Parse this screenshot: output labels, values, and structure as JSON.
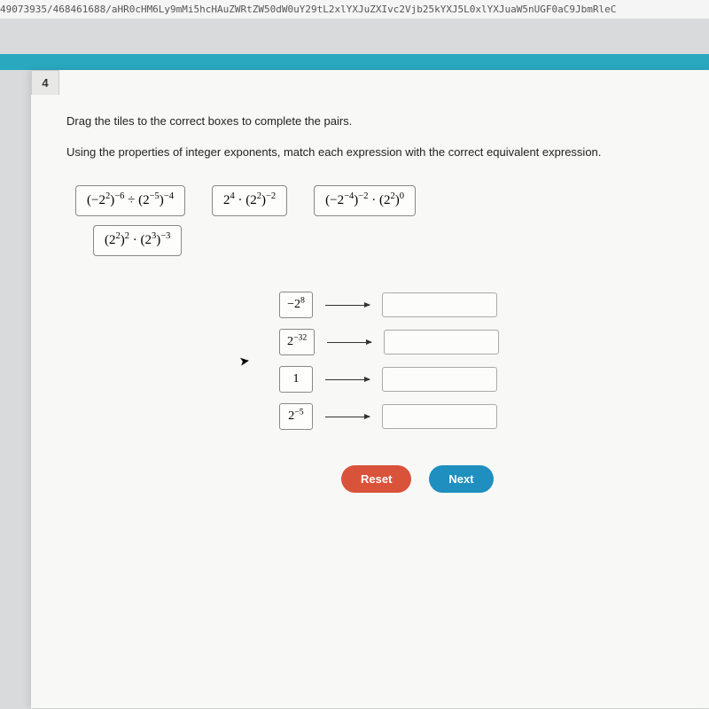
{
  "url": "49073935/468461688/aHR0cHM6Ly9mMi5hcHAuZWRtZW50dW0uY29tL2xlYXJuZXIvc2Vjb25kYXJ5L0xlYXJuaW5nUGF0aC9JbmRleC",
  "question": {
    "number": "4",
    "instruction": "Drag the tiles to the correct boxes to complete the pairs.",
    "subinstruction": "Using the properties of integer exponents, match each expression with the correct equivalent expression."
  },
  "tiles": {
    "t1": "(−2²)⁻⁶ ÷ (2⁻⁵)⁻⁴",
    "t2": "2⁴ · (2²)⁻²",
    "t3": "(−2⁻⁴)⁻² · (2²)⁰",
    "t4": "(2²)² · (2³)⁻³"
  },
  "answers": {
    "a1": "−2⁸",
    "a2": "2⁻³²",
    "a3": "1",
    "a4": "2⁻⁵"
  },
  "buttons": {
    "reset": "Reset",
    "next": "Next"
  }
}
